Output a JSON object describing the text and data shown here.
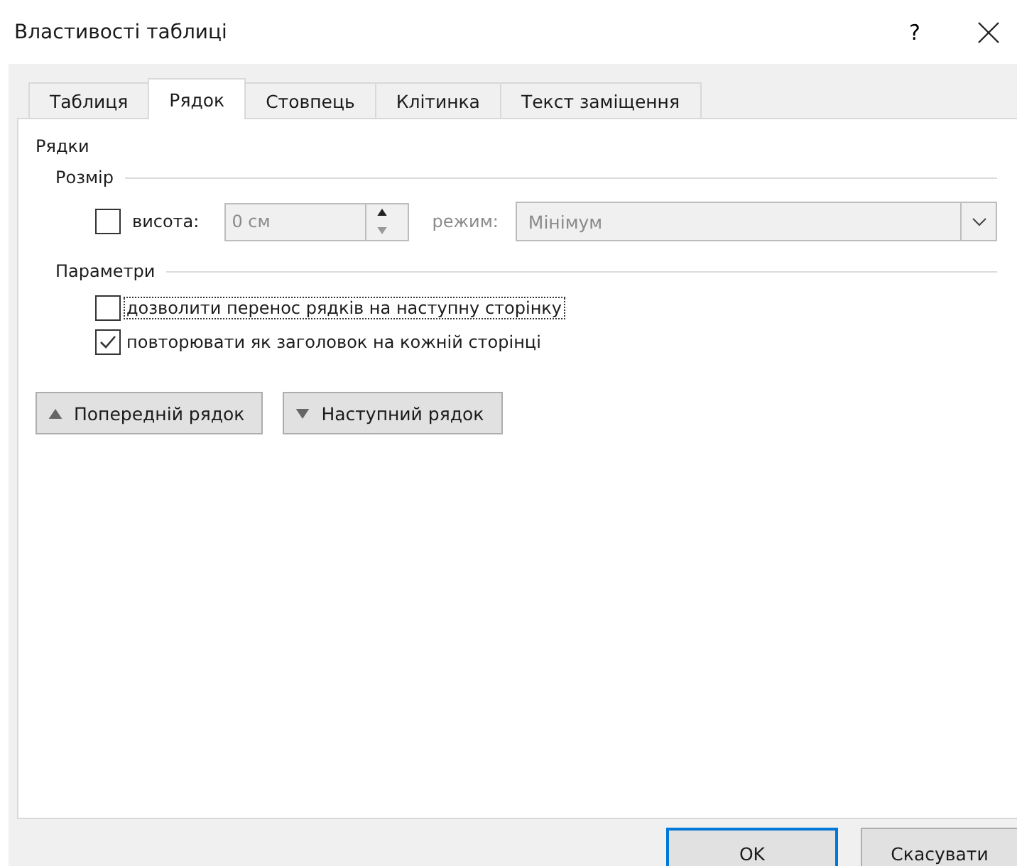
{
  "window": {
    "title": "Властивості таблиці",
    "help": "?"
  },
  "tabs": [
    {
      "label": "Таблиця",
      "selected": false
    },
    {
      "label": "Рядок",
      "selected": true
    },
    {
      "label": "Стовпець",
      "selected": false
    },
    {
      "label": "Клітинка",
      "selected": false
    },
    {
      "label": "Текст заміщення",
      "selected": false
    }
  ],
  "section_title": "Рядки",
  "size": {
    "title": "Розмір",
    "height_checkbox": {
      "label": "висота:",
      "checked": false
    },
    "height_field": {
      "value": "0 см",
      "disabled": true
    },
    "mode_label": "режим:",
    "mode_select": {
      "value": "Мінімум",
      "disabled": true
    }
  },
  "options": {
    "title": "Параметри",
    "checkboxes": [
      {
        "label": "дозволити перенос рядків на наступну сторінку",
        "checked": false,
        "focused": true
      },
      {
        "label": "повторювати як заголовок на кожній сторінці",
        "checked": true,
        "focused": false
      }
    ]
  },
  "nav_buttons": [
    {
      "label": "Попередній рядок",
      "kind": "up"
    },
    {
      "label": "Наступний рядок",
      "kind": "down"
    }
  ],
  "footer_buttons": [
    {
      "label": "OK",
      "default": true
    },
    {
      "label": "Скасувати",
      "default": false
    }
  ]
}
